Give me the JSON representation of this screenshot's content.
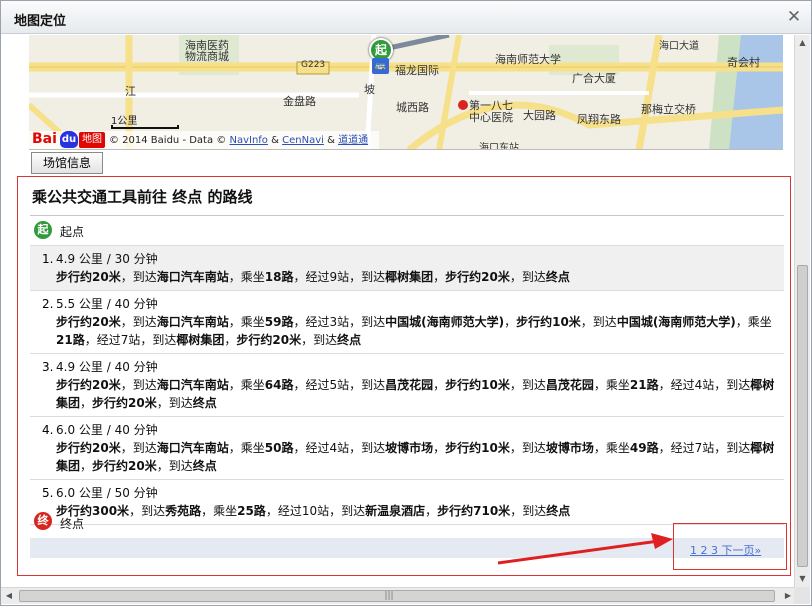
{
  "window": {
    "title": "地图定位",
    "close_glyph": "✕"
  },
  "map": {
    "labels": {
      "hospital": "海南医药",
      "mall": "物流商城",
      "normal_univ": "海南师范大学",
      "jinding": "金盘路",
      "g223": "G223",
      "fulong": "福龙国际",
      "guangda": "广合大厦",
      "qiyi": "奇会村",
      "road_jiang": "江",
      "pofu": "坡",
      "ubalu": "城西路",
      "hosp_187": "第一八七",
      "center_hosp": "中心医院",
      "daying": "大园路",
      "fenghuang": "凤翔东路",
      "nameilong": "那梅立交桥",
      "haikou_station": "海口东站",
      "haikou_road": "海口大道"
    },
    "scale_label": "1公里",
    "copyright_prefix": "© 2014 Baidu - Data ©",
    "navinfo": "NavInfo",
    "amp1": "&",
    "cennavi": "CenNavi",
    "amp2": "&",
    "daodao": "道道通",
    "logo_bai": "Bai",
    "logo_du": "du",
    "logo_ditu": "地图",
    "start_marker": "起",
    "bus_icon": "🚌"
  },
  "tab": {
    "label": "场馆信息"
  },
  "panel": {
    "title": "乘公共交通工具前往 终点 的路线",
    "start_badge": "起",
    "start_label": "起点",
    "end_badge": "终",
    "end_label": "终点",
    "pager_link": "1 2 3 下一页»"
  },
  "routes": [
    {
      "num": "1.",
      "head": "4.9 公里 / 30 分钟",
      "segments": [
        {
          "t": "步行约20米",
          "b": true
        },
        {
          "t": "，到达",
          "b": false
        },
        {
          "t": "海口汽车南站",
          "b": true
        },
        {
          "t": "，乘坐",
          "b": false
        },
        {
          "t": "18路",
          "b": true
        },
        {
          "t": "，经过9站，到达",
          "b": false
        },
        {
          "t": "椰树集团",
          "b": true
        },
        {
          "t": "，",
          "b": false
        },
        {
          "t": "步行约20米",
          "b": true
        },
        {
          "t": "，到达",
          "b": false
        },
        {
          "t": "终点",
          "b": true
        }
      ]
    },
    {
      "num": "2.",
      "head": "5.5 公里 / 40 分钟",
      "segments": [
        {
          "t": "步行约20米",
          "b": true
        },
        {
          "t": "，到达",
          "b": false
        },
        {
          "t": "海口汽车南站",
          "b": true
        },
        {
          "t": "，乘坐",
          "b": false
        },
        {
          "t": "59路",
          "b": true
        },
        {
          "t": "，经过3站，到达",
          "b": false
        },
        {
          "t": "中国城(海南师范大学)",
          "b": true
        },
        {
          "t": "，",
          "b": false
        },
        {
          "t": "步行约10米",
          "b": true
        },
        {
          "t": "，到达",
          "b": false
        },
        {
          "t": "中国城(海南师范大学)",
          "b": true
        },
        {
          "t": "，乘坐",
          "b": false
        },
        {
          "t": "21路",
          "b": true
        },
        {
          "t": "，经过7站，到达",
          "b": false
        },
        {
          "t": "椰树集团",
          "b": true
        },
        {
          "t": "，",
          "b": false
        },
        {
          "t": "步行约20米",
          "b": true
        },
        {
          "t": "，到达",
          "b": false
        },
        {
          "t": "终点",
          "b": true
        }
      ]
    },
    {
      "num": "3.",
      "head": "4.9 公里 / 40 分钟",
      "segments": [
        {
          "t": "步行约20米",
          "b": true
        },
        {
          "t": "，到达",
          "b": false
        },
        {
          "t": "海口汽车南站",
          "b": true
        },
        {
          "t": "，乘坐",
          "b": false
        },
        {
          "t": "64路",
          "b": true
        },
        {
          "t": "，经过5站，到达",
          "b": false
        },
        {
          "t": "昌茂花园",
          "b": true
        },
        {
          "t": "，",
          "b": false
        },
        {
          "t": "步行约10米",
          "b": true
        },
        {
          "t": "，到达",
          "b": false
        },
        {
          "t": "昌茂花园",
          "b": true
        },
        {
          "t": "，乘坐",
          "b": false
        },
        {
          "t": "21路",
          "b": true
        },
        {
          "t": "，经过4站，到达",
          "b": false
        },
        {
          "t": "椰树集团",
          "b": true
        },
        {
          "t": "，",
          "b": false
        },
        {
          "t": "步行约20米",
          "b": true
        },
        {
          "t": "，到达",
          "b": false
        },
        {
          "t": "终点",
          "b": true
        }
      ]
    },
    {
      "num": "4.",
      "head": "6.0 公里 / 40 分钟",
      "segments": [
        {
          "t": "步行约20米",
          "b": true
        },
        {
          "t": "，到达",
          "b": false
        },
        {
          "t": "海口汽车南站",
          "b": true
        },
        {
          "t": "，乘坐",
          "b": false
        },
        {
          "t": "50路",
          "b": true
        },
        {
          "t": "，经过4站，到达",
          "b": false
        },
        {
          "t": "坡博市场",
          "b": true
        },
        {
          "t": "，",
          "b": false
        },
        {
          "t": "步行约10米",
          "b": true
        },
        {
          "t": "，到达",
          "b": false
        },
        {
          "t": "坡博市场",
          "b": true
        },
        {
          "t": "，乘坐",
          "b": false
        },
        {
          "t": "49路",
          "b": true
        },
        {
          "t": "，经过7站，到达",
          "b": false
        },
        {
          "t": "椰树集团",
          "b": true
        },
        {
          "t": "，",
          "b": false
        },
        {
          "t": "步行约20米",
          "b": true
        },
        {
          "t": "，到达",
          "b": false
        },
        {
          "t": "终点",
          "b": true
        }
      ]
    },
    {
      "num": "5.",
      "head": "6.0 公里 / 50 分钟",
      "segments": [
        {
          "t": "步行约300米",
          "b": true
        },
        {
          "t": "，到达",
          "b": false
        },
        {
          "t": "秀苑路",
          "b": true
        },
        {
          "t": "，乘坐",
          "b": false
        },
        {
          "t": "25路",
          "b": true
        },
        {
          "t": "，经过10站，到达",
          "b": false
        },
        {
          "t": "新温泉酒店",
          "b": true
        },
        {
          "t": "，",
          "b": false
        },
        {
          "t": "步行约710米",
          "b": true
        },
        {
          "t": "，到达",
          "b": false
        },
        {
          "t": "终点",
          "b": true
        }
      ]
    }
  ],
  "scroll": {
    "up": "▲",
    "down": "▼",
    "left": "◀",
    "right": "▶",
    "grip": "|||"
  },
  "colors": {
    "highlight": "#d33333",
    "start": "#2f9b3a",
    "end": "#d8261f",
    "link": "#4d6fd0"
  }
}
